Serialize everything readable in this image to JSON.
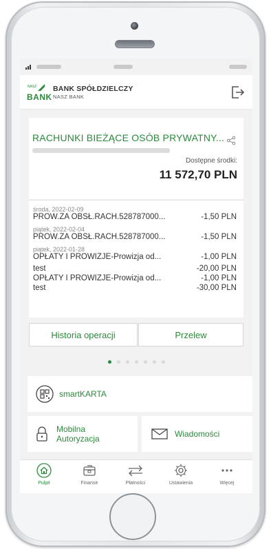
{
  "bank": {
    "logo_small": "NASZ",
    "logo_word": "BANK",
    "name": "BANK SPÓŁDZIELCZY",
    "subname": "NASZ BANK"
  },
  "account": {
    "title": "RACHUNKI BIEŻĄCE OSÓB PRYWATNY...",
    "available_label": "Dostępne środki:",
    "available_value": "11 572,70 PLN"
  },
  "operations": [
    {
      "date": "środa, 2022-02-09",
      "desc": "PROW.ZA OBSŁ.RACH.528787000...",
      "amount": "-1,50 PLN"
    },
    {
      "date": "piątek, 2022-02-04",
      "desc": "PROW.ZA OBSŁ.RACH.528787000...",
      "amount": "-1,50 PLN"
    },
    {
      "date": "piątek, 2022-01-28",
      "desc": "OPŁATY I PROWIZJE-Prowizja od...",
      "amount": "-1,00 PLN"
    },
    {
      "date": "",
      "desc": "test",
      "amount": "-20,00 PLN"
    },
    {
      "date": "",
      "desc": "OPŁATY I PROWIZJE-Prowizja od...",
      "amount": "-1,00 PLN"
    },
    {
      "date": "",
      "desc": "test",
      "amount": "-30,00 PLN"
    }
  ],
  "buttons": {
    "history": "Historia operacji",
    "transfer": "Przelew"
  },
  "tiles": {
    "smartkarta": "smartKARTA",
    "mobile_auth_line1": "Mobilna",
    "mobile_auth_line2": "Autoryzacja",
    "messages": "Wiadomości"
  },
  "tabs": [
    {
      "label": "Pulpit",
      "icon": "home-icon",
      "active": true
    },
    {
      "label": "Finanse",
      "icon": "wallet-icon",
      "active": false
    },
    {
      "label": "Płatności",
      "icon": "transfer-arrows-icon",
      "active": false
    },
    {
      "label": "Ustawienia",
      "icon": "gear-icon",
      "active": false
    },
    {
      "label": "Więcej",
      "icon": "more-icon",
      "active": false
    }
  ],
  "colors": {
    "brand": "#2a8a3a",
    "background": "#f2f2f2",
    "text": "#333333"
  },
  "carousel": {
    "active_index": 0,
    "count": 7
  }
}
